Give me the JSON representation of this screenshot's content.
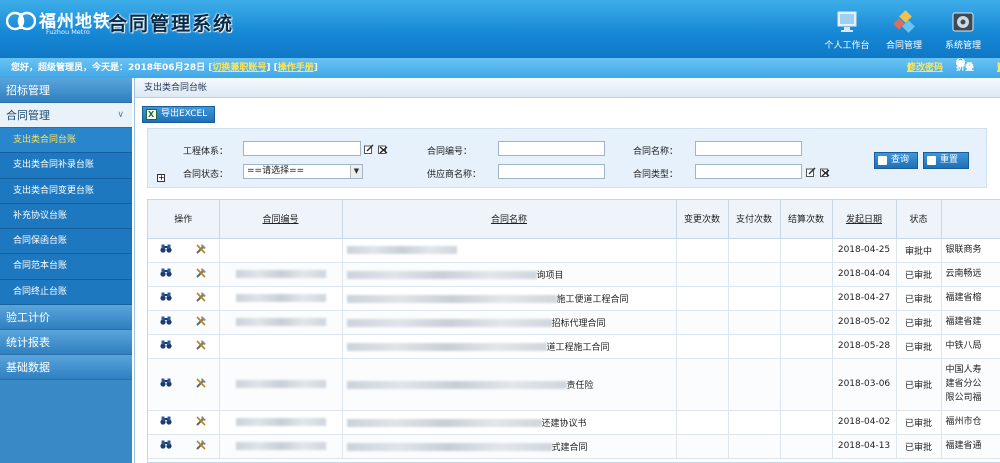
{
  "header": {
    "logo_cn": "福州地铁",
    "logo_en": "Fuzhou Metro",
    "system_title": "合同管理系统",
    "buttons": [
      {
        "label": "个人工作台",
        "icon": "monitor-icon"
      },
      {
        "label": "合同管理",
        "icon": "contract-icon"
      },
      {
        "label": "系统管理",
        "icon": "settings-icon"
      }
    ]
  },
  "infobar": {
    "greeting": "您好，超级管理员，今天是：2018年06月28日",
    "switch_account": "切换兼职账号",
    "manual": "操作手册",
    "change_password": "修改密码",
    "collapse": "折叠",
    "logout": "注销"
  },
  "sidebar": {
    "menus": [
      {
        "label": "招标管理"
      },
      {
        "label": "合同管理",
        "open": true,
        "items": [
          {
            "label": "支出类合同台账",
            "active": true
          },
          {
            "label": "支出类合同补录台账"
          },
          {
            "label": "支出类合同变更台账"
          },
          {
            "label": "补充协议台账"
          },
          {
            "label": "合同保函台账"
          },
          {
            "label": "合同范本台账"
          },
          {
            "label": "合同终止台账"
          }
        ]
      },
      {
        "label": "验工计价"
      },
      {
        "label": "统计报表"
      },
      {
        "label": "基础数据"
      }
    ]
  },
  "breadcrumb": "支出类合同台帐",
  "toolbar": {
    "export_label": "导出EXCEL"
  },
  "search": {
    "project_system_label": "工程体系：",
    "contract_no_label": "合同编号：",
    "contract_name_label": "合同名称：",
    "contract_status_label": "合同状态：",
    "contract_status_value": "==请选择==",
    "supplier_label": "供应商名称：",
    "contract_type_label": "合同类型：",
    "query_label": "查询",
    "reset_label": "重置"
  },
  "table": {
    "columns": [
      "操作",
      "合同编号",
      "合同名称",
      "变更次数",
      "支付次数",
      "结算次数",
      "发起日期",
      "状态",
      ""
    ],
    "rows": [
      {
        "name_tail": "",
        "date": "2018-04-25",
        "status": "审批中",
        "extra": "银联商务",
        "no": false
      },
      {
        "name_tail": "询项目",
        "date": "2018-04-04",
        "status": "已审批",
        "extra": "云南畅远",
        "no": true
      },
      {
        "name_tail": "施工便道工程合同",
        "date": "2018-04-27",
        "status": "已审批",
        "extra": "福建省榕",
        "no": true
      },
      {
        "name_tail": "招标代理合同",
        "date": "2018-05-02",
        "status": "已审批",
        "extra": "福建省建",
        "no": true
      },
      {
        "name_tail": "道工程施工合同",
        "date": "2018-05-28",
        "status": "已审批",
        "extra": "中铁八局",
        "no": false
      },
      {
        "name_tail": "责任险",
        "date": "2018-03-06",
        "status": "已审批",
        "extra": "中国人寿\n建省分公\n限公司福",
        "no": true,
        "tall": true
      },
      {
        "name_tail": "还建协议书",
        "date": "2018-04-02",
        "status": "已审批",
        "extra": "福州市仓",
        "no": true
      },
      {
        "name_tail": "式建合同",
        "date": "2018-04-13",
        "status": "已审批",
        "extra": "福建省通",
        "no": true
      }
    ]
  },
  "colors": {
    "header_blue": "#1789d6",
    "sidebar_blue": "#1e78c0",
    "active_yellow": "#ffe35a"
  }
}
